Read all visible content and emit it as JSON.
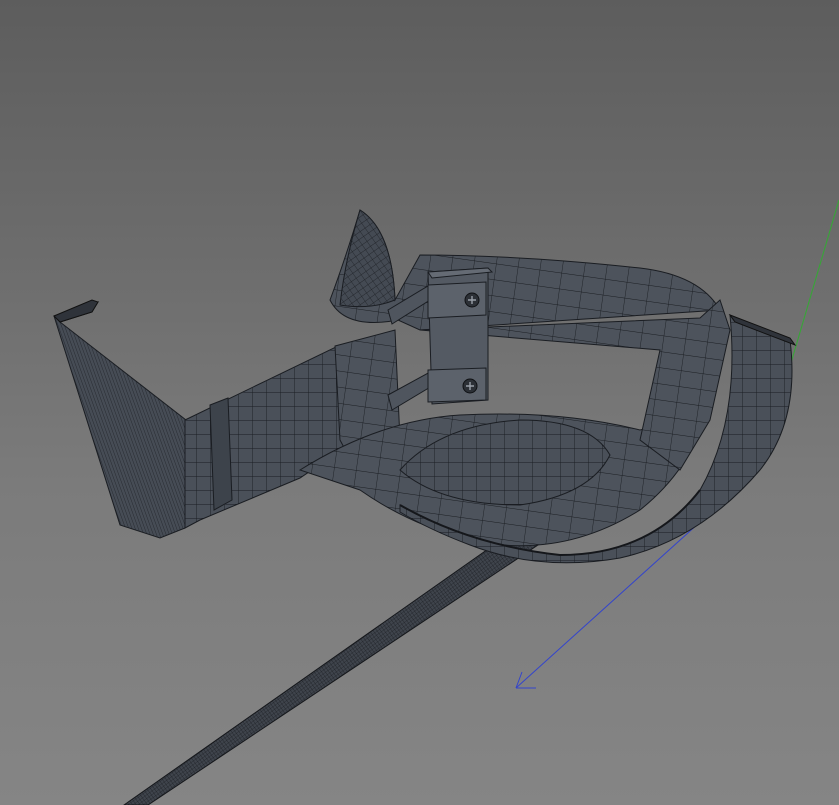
{
  "viewport": {
    "background_top": "#5d5d5d",
    "background_bottom": "#858585"
  },
  "model": {
    "description_icon": "mesh-wireframe",
    "surface_color": "#4a5059",
    "surface_shade": "#3d434b",
    "edge_color": "#1a1d22"
  },
  "axes": {
    "x_color": "#cc3333",
    "y_color": "#33aa33",
    "z_color": "#3344cc"
  }
}
